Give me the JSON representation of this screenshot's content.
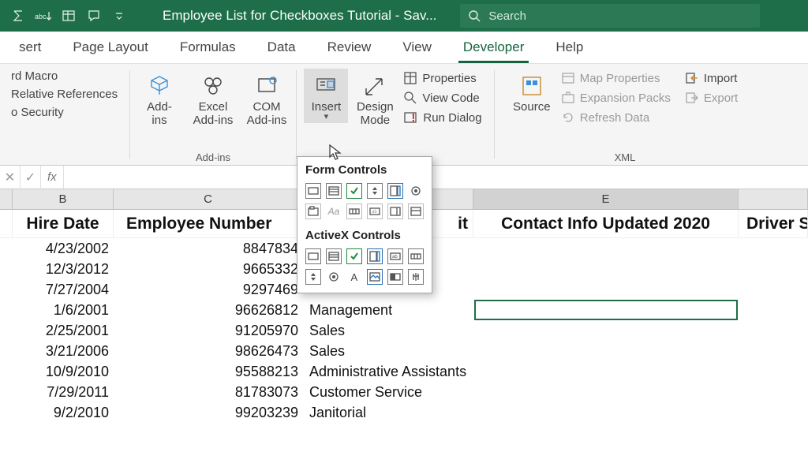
{
  "titlebar": {
    "doc_title": "Employee List for Checkboxes Tutorial  -  Sav...",
    "search_placeholder": "Search"
  },
  "tabs": {
    "items": [
      "sert",
      "Page Layout",
      "Formulas",
      "Data",
      "Review",
      "View",
      "Developer",
      "Help"
    ],
    "active": "Developer"
  },
  "ribbon": {
    "code": {
      "items": [
        "rd Macro",
        "Relative References",
        "o Security"
      ]
    },
    "addins": {
      "group_label": "Add-ins",
      "addins_label": "Add-\nins",
      "excel_addins_label": "Excel\nAdd-ins",
      "com_addins_label": "COM\nAdd-ins"
    },
    "controls": {
      "insert_label": "Insert",
      "design_label": "Design\nMode",
      "properties_label": "Properties",
      "viewcode_label": "View Code",
      "rundialog_label": "Run Dialog"
    },
    "xml": {
      "group_label": "XML",
      "source_label": "Source",
      "map_label": "Map Properties",
      "expansion_label": "Expansion Packs",
      "refresh_label": "Refresh Data",
      "import_label": "Import",
      "export_label": "Export"
    }
  },
  "fx": {
    "label": "fx"
  },
  "grid": {
    "col_labels": [
      "",
      "B",
      "C",
      "",
      "E",
      ""
    ],
    "headers": {
      "B": "Hire Date",
      "C": "Employee Number",
      "D_visible": "it",
      "E": "Contact Info Updated 2020",
      "F": "Driver S"
    },
    "rows": [
      {
        "B": "4/23/2002",
        "C": "8847834",
        "D": ""
      },
      {
        "B": "12/3/2012",
        "C": "9665332",
        "D": ""
      },
      {
        "B": "7/27/2004",
        "C": "9297469",
        "D": ""
      },
      {
        "B": "1/6/2001",
        "C": "96626812",
        "D": "Management"
      },
      {
        "B": "2/25/2001",
        "C": "91205970",
        "D": "Sales"
      },
      {
        "B": "3/21/2006",
        "C": "98626473",
        "D": "Sales"
      },
      {
        "B": "10/9/2010",
        "C": "95588213",
        "D": "Administrative Assistants"
      },
      {
        "B": "7/29/2011",
        "C": "81783073",
        "D": "Customer Service"
      },
      {
        "B": "9/2/2010",
        "C": "99203239",
        "D": "Janitorial"
      }
    ]
  },
  "popup": {
    "form_label": "Form Controls",
    "activex_label": "ActiveX Controls"
  }
}
